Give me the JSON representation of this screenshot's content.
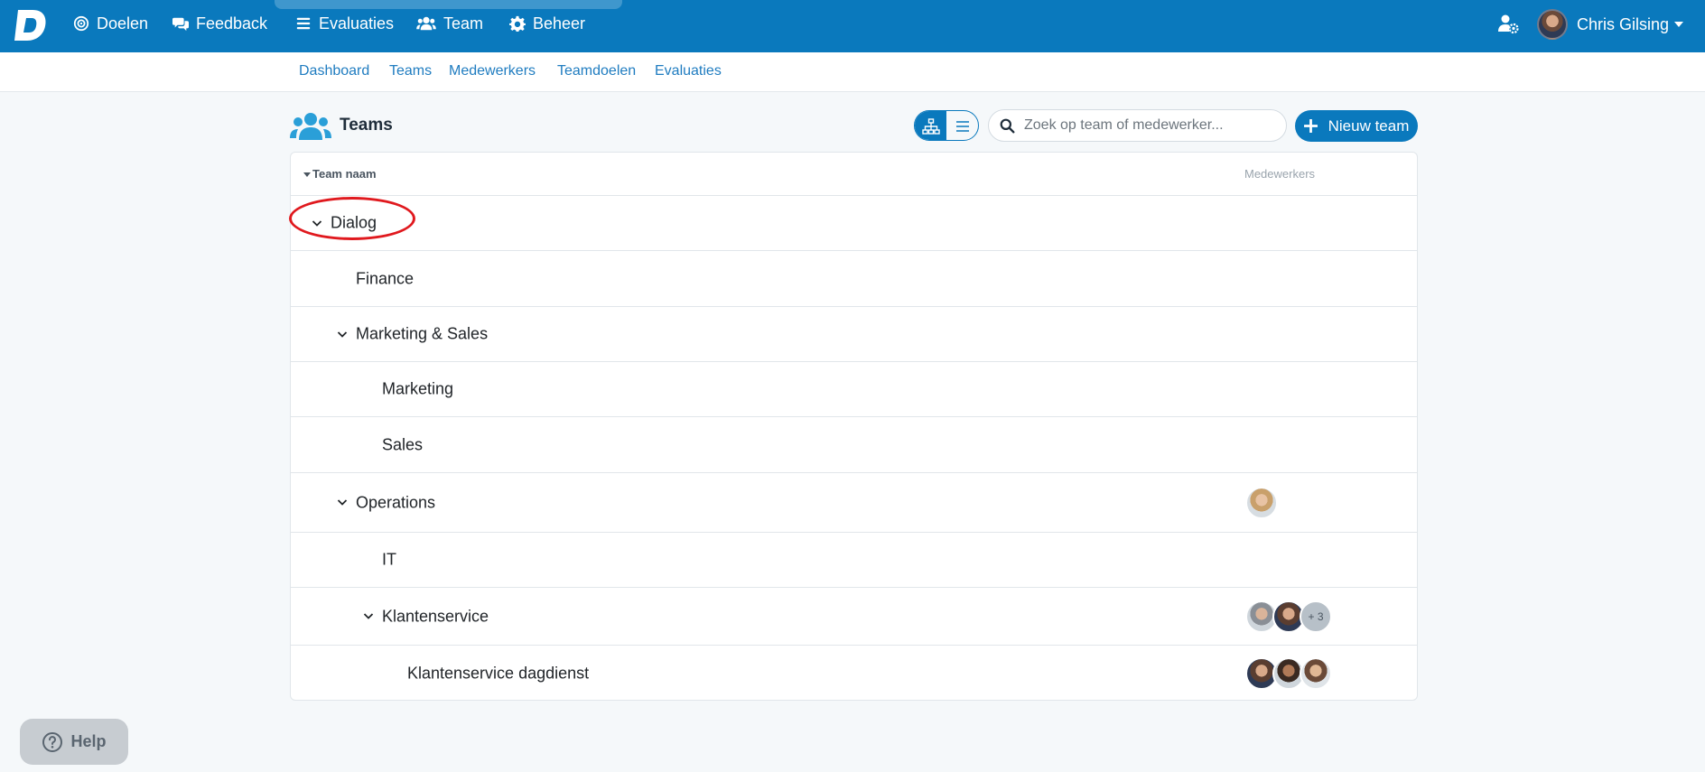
{
  "topnav": {
    "items": [
      {
        "label": "Doelen",
        "icon": "target-icon"
      },
      {
        "label": "Feedback",
        "icon": "comments-icon"
      },
      {
        "label": "Evaluaties",
        "icon": "list-icon"
      },
      {
        "label": "Team",
        "icon": "users-icon"
      },
      {
        "label": "Beheer",
        "icon": "gear-icon"
      }
    ],
    "user_name": "Chris Gilsing"
  },
  "subnav": {
    "links": [
      "Dashboard",
      "Teams",
      "Medewerkers",
      "Teamdoelen",
      "Evaluaties"
    ]
  },
  "page": {
    "title": "Teams",
    "search_placeholder": "Zoek op team of medewerker...",
    "new_team_label": "Nieuw team"
  },
  "table": {
    "col_name": "Team naam",
    "col_members": "Medewerkers",
    "rows": [
      {
        "name": "Dialog",
        "level": 0,
        "expanded": true,
        "members": []
      },
      {
        "name": "Finance",
        "level": 1,
        "expanded": false,
        "members": []
      },
      {
        "name": "Marketing & Sales",
        "level": 1,
        "expanded": true,
        "members": []
      },
      {
        "name": "Marketing",
        "level": 2,
        "expanded": false,
        "members": []
      },
      {
        "name": "Sales",
        "level": 2,
        "expanded": false,
        "members": []
      },
      {
        "name": "Operations",
        "level": 1,
        "expanded": true,
        "members": [
          "avatar"
        ]
      },
      {
        "name": "IT",
        "level": 2,
        "expanded": false,
        "members": []
      },
      {
        "name": "Klantenservice",
        "level": 2,
        "expanded": true,
        "members": [
          "avatar",
          "avatar"
        ],
        "more": "+ 3"
      },
      {
        "name": "Klantenservice dagdienst",
        "level": 3,
        "expanded": false,
        "members": [
          "avatar",
          "avatar",
          "avatar"
        ]
      }
    ]
  },
  "help": {
    "label": "Help"
  },
  "colors": {
    "brand": "#0a79bd",
    "link": "#1f7cc0",
    "highlight": "#e0191e"
  }
}
